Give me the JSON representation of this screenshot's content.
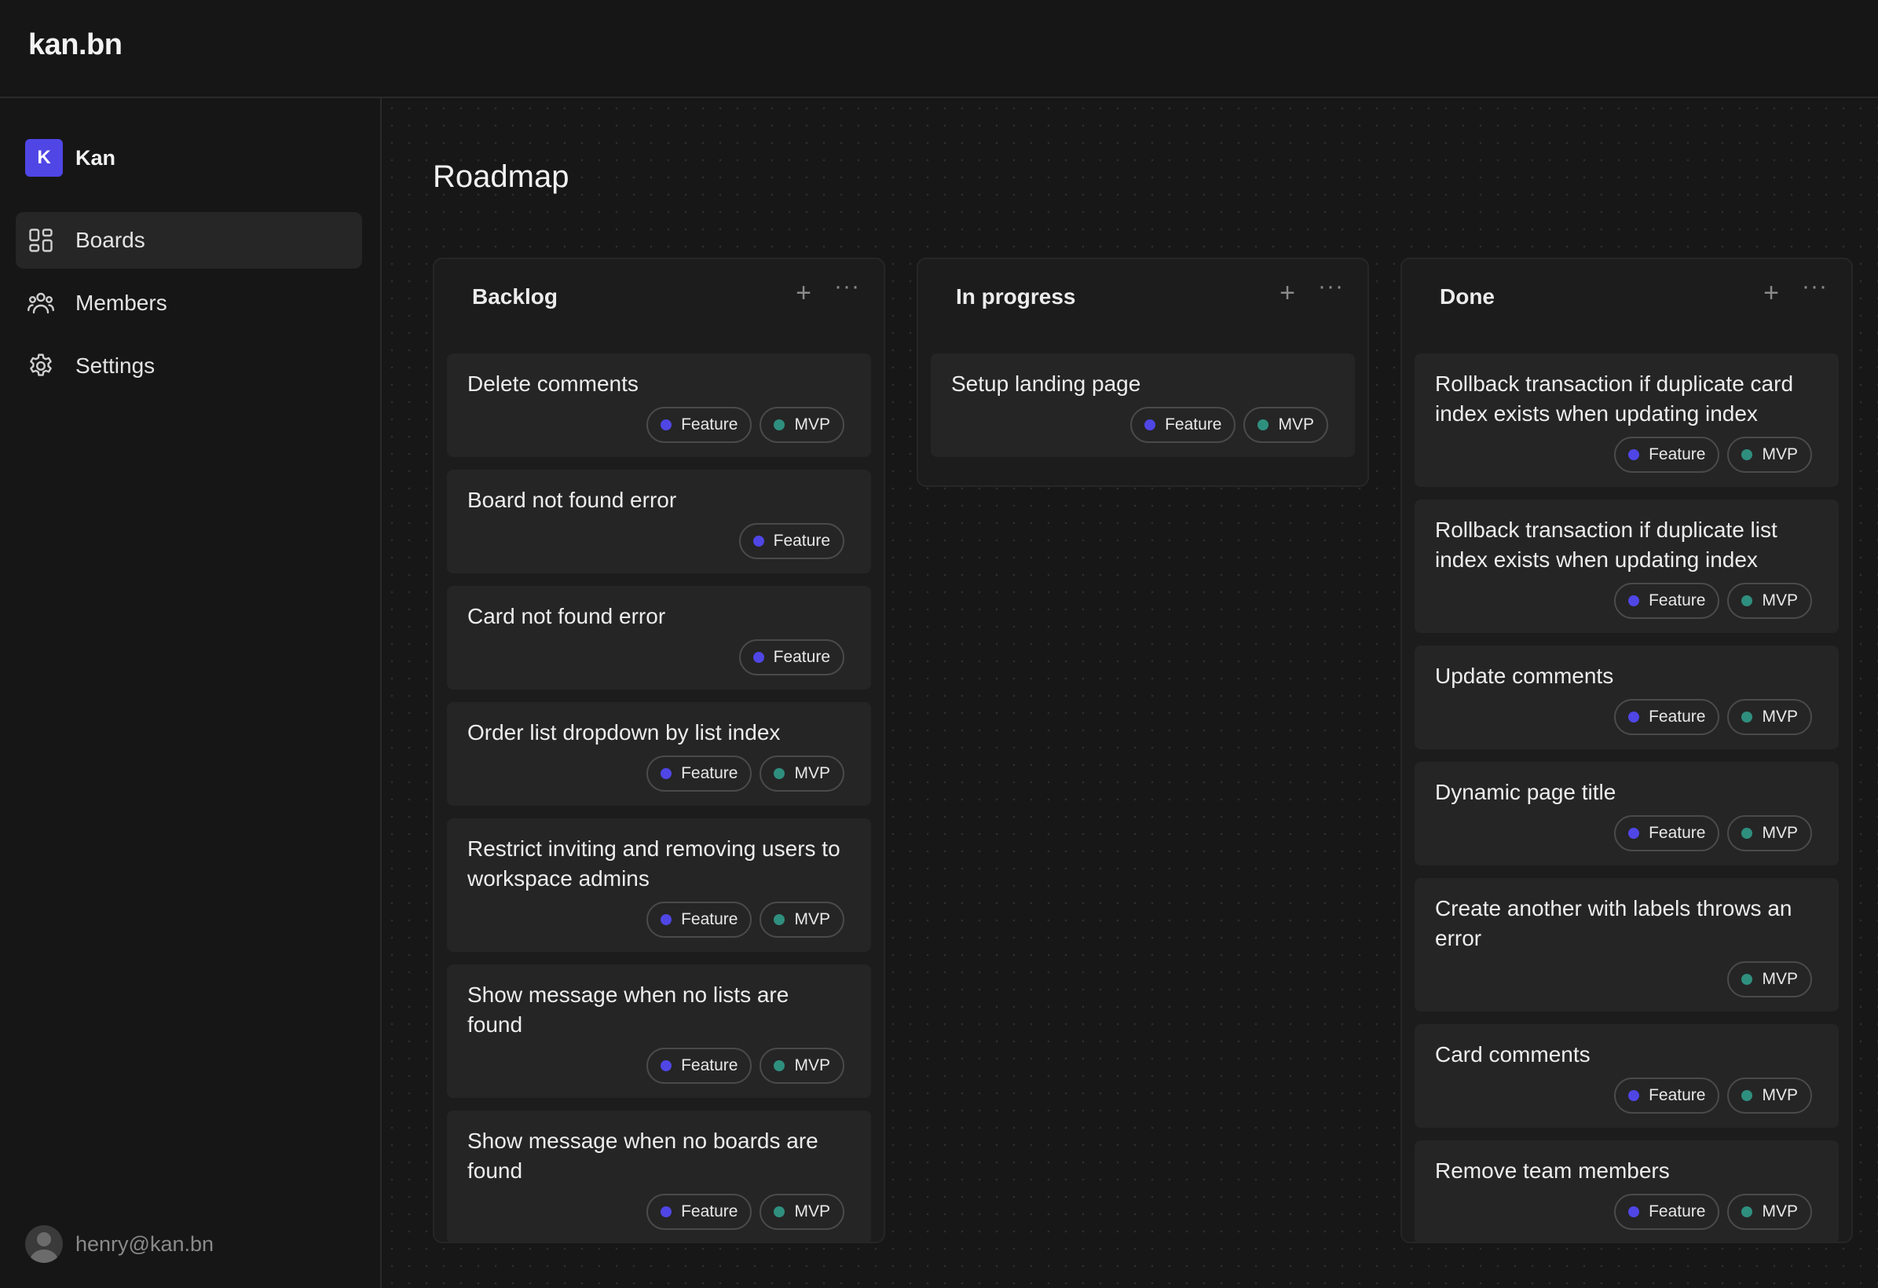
{
  "app": {
    "logo": "kan.bn"
  },
  "workspace": {
    "initial": "K",
    "name": "Kan",
    "color": "#4f46e5"
  },
  "nav": [
    {
      "label": "Boards",
      "icon": "boards-icon",
      "active": true
    },
    {
      "label": "Members",
      "icon": "members-icon",
      "active": false
    },
    {
      "label": "Settings",
      "icon": "settings-icon",
      "active": false
    }
  ],
  "user": {
    "email": "henry@kan.bn"
  },
  "board": {
    "title": "Roadmap"
  },
  "label_colors": {
    "Feature": "#4f46e5",
    "MVP": "#2f8f7f"
  },
  "lists": [
    {
      "title": "Backlog",
      "cards": [
        {
          "title": "Delete comments",
          "labels": [
            "Feature",
            "MVP"
          ]
        },
        {
          "title": "Board not found error",
          "labels": [
            "Feature"
          ]
        },
        {
          "title": "Card not found error",
          "labels": [
            "Feature"
          ]
        },
        {
          "title": "Order list dropdown by list index",
          "labels": [
            "Feature",
            "MVP"
          ]
        },
        {
          "title": "Restrict inviting and removing users to workspace admins",
          "labels": [
            "Feature",
            "MVP"
          ]
        },
        {
          "title": "Show message when no lists are found",
          "labels": [
            "Feature",
            "MVP"
          ]
        },
        {
          "title": "Show message when no boards are found",
          "labels": [
            "Feature",
            "MVP"
          ]
        }
      ]
    },
    {
      "title": "In progress",
      "cards": [
        {
          "title": "Setup landing page",
          "labels": [
            "Feature",
            "MVP"
          ]
        }
      ]
    },
    {
      "title": "Done",
      "cards": [
        {
          "title": "Rollback transaction if duplicate card index exists when updating index",
          "labels": [
            "Feature",
            "MVP"
          ]
        },
        {
          "title": "Rollback transaction if duplicate list index exists when updating index",
          "labels": [
            "Feature",
            "MVP"
          ]
        },
        {
          "title": "Update comments",
          "labels": [
            "Feature",
            "MVP"
          ]
        },
        {
          "title": "Dynamic page title",
          "labels": [
            "Feature",
            "MVP"
          ]
        },
        {
          "title": "Create another with labels throws an error",
          "labels": [
            "MVP"
          ]
        },
        {
          "title": "Card comments",
          "labels": [
            "Feature",
            "MVP"
          ]
        },
        {
          "title": "Remove team members",
          "labels": [
            "Feature",
            "MVP"
          ]
        }
      ]
    }
  ]
}
